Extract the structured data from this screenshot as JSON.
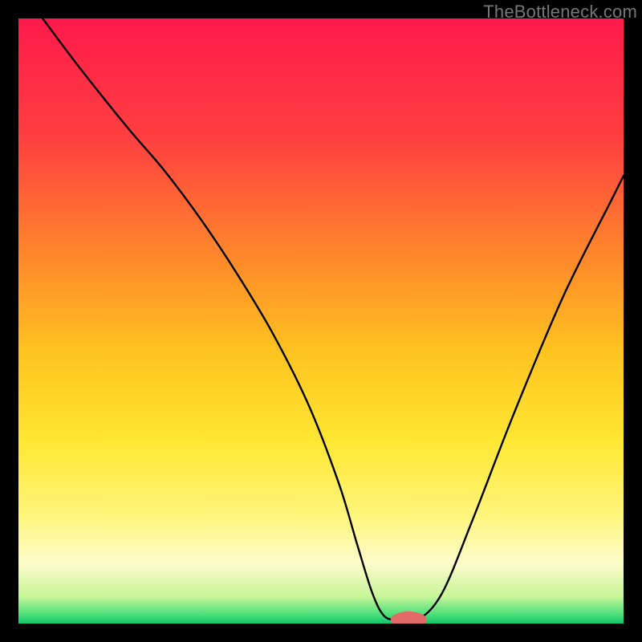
{
  "watermark": "TheBottleneck.com",
  "chart_data": {
    "type": "line",
    "title": "",
    "xlabel": "",
    "ylabel": "",
    "xlim": [
      0,
      100
    ],
    "ylim": [
      0,
      100
    ],
    "grid": false,
    "legend": false,
    "background_gradient": [
      {
        "pos": 0.0,
        "color": "#ff1a4b"
      },
      {
        "pos": 0.2,
        "color": "#ff4040"
      },
      {
        "pos": 0.4,
        "color": "#ff8a2a"
      },
      {
        "pos": 0.55,
        "color": "#ffc31f"
      },
      {
        "pos": 0.7,
        "color": "#ffe733"
      },
      {
        "pos": 0.82,
        "color": "#fff57a"
      },
      {
        "pos": 0.9,
        "color": "#fcfccb"
      },
      {
        "pos": 0.955,
        "color": "#c8f599"
      },
      {
        "pos": 0.985,
        "color": "#4be07a"
      },
      {
        "pos": 1.0,
        "color": "#14c46a"
      }
    ],
    "series": [
      {
        "name": "bottleneck-curve",
        "x": [
          4,
          10,
          18,
          24,
          30,
          36,
          42,
          48,
          53,
          56,
          58.5,
          60.5,
          63,
          66,
          70,
          75,
          82,
          90,
          98,
          100
        ],
        "y": [
          100,
          92,
          82,
          75,
          67,
          58,
          48,
          36,
          23,
          13,
          5,
          1.2,
          0.6,
          0.6,
          5,
          17,
          35,
          54,
          70,
          74
        ]
      }
    ],
    "marker": {
      "x": 64.5,
      "y": 0.6,
      "color": "#e46a6a",
      "rx": 3.0,
      "ry": 1.4
    }
  }
}
